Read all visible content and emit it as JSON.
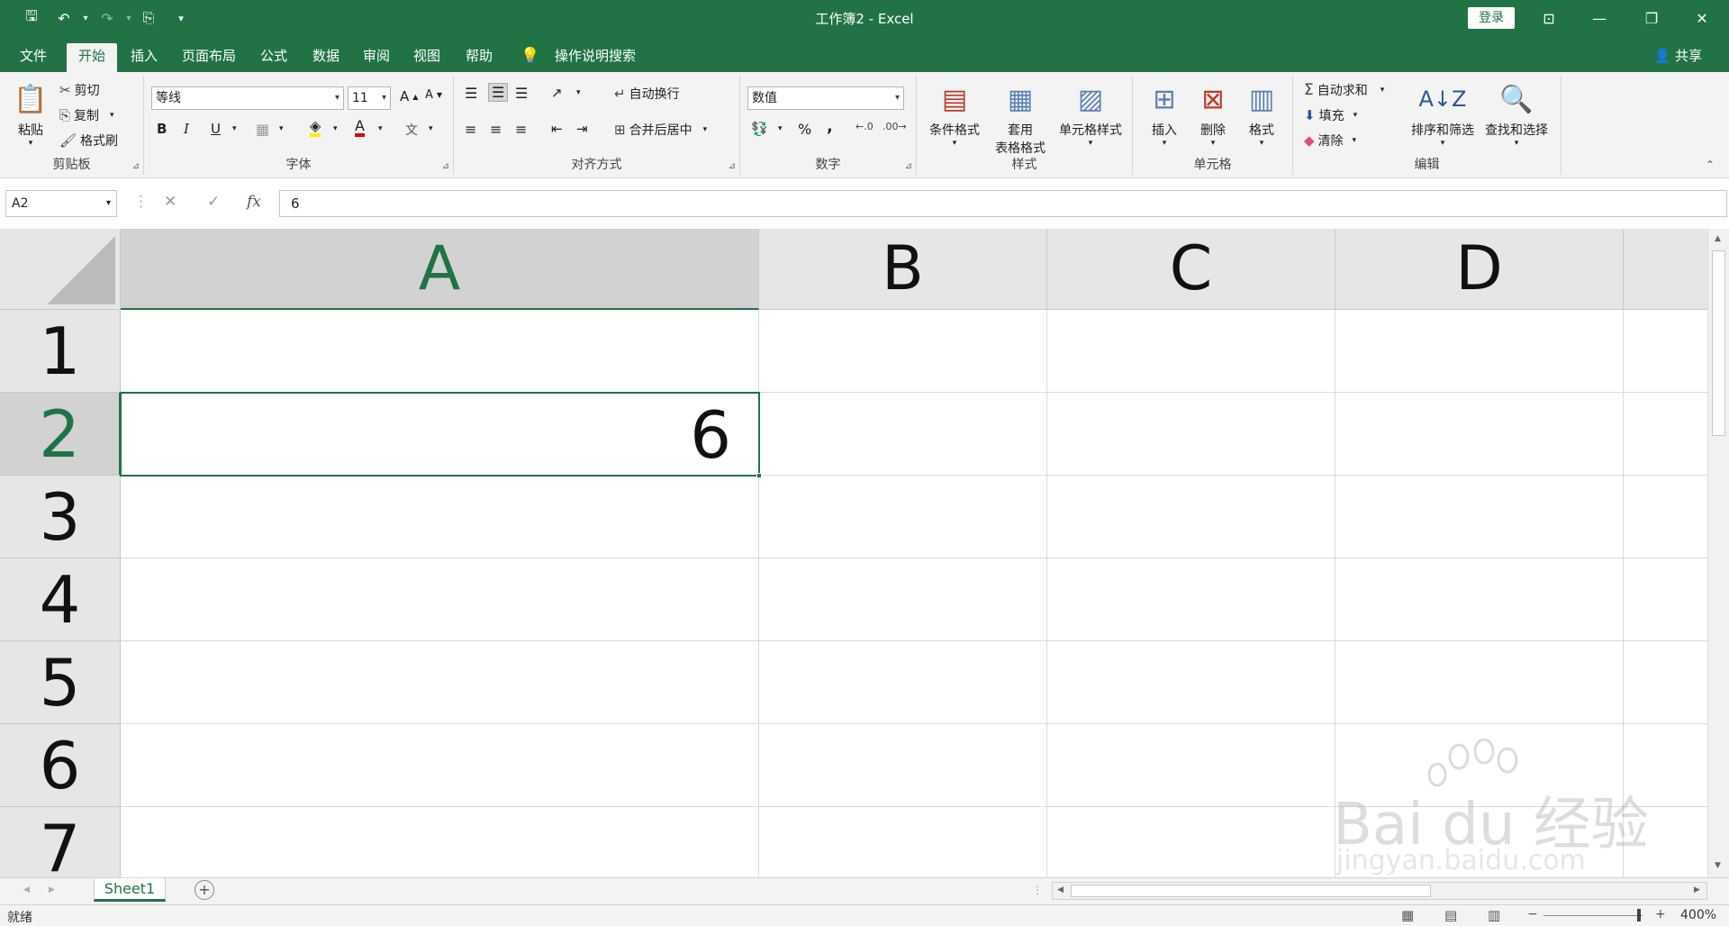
{
  "title_bar": {
    "title": "工作簿2  -  Excel",
    "login_label": "登录",
    "quick_access": [
      "save-icon",
      "undo-icon",
      "redo-icon",
      "touch-mode-icon",
      "customize-icon"
    ]
  },
  "tabs": [
    {
      "label": "文件",
      "active": false
    },
    {
      "label": "开始",
      "active": true
    },
    {
      "label": "插入",
      "active": false
    },
    {
      "label": "页面布局",
      "active": false
    },
    {
      "label": "公式",
      "active": false
    },
    {
      "label": "数据",
      "active": false
    },
    {
      "label": "审阅",
      "active": false
    },
    {
      "label": "视图",
      "active": false
    },
    {
      "label": "帮助",
      "active": false
    }
  ],
  "tell_me": "操作说明搜索",
  "share_label": "共享",
  "ribbon": {
    "clipboard": {
      "label": "剪贴板",
      "paste": "粘贴",
      "cut": "剪切",
      "copy": "复制",
      "format_painter": "格式刷"
    },
    "font": {
      "label": "字体",
      "font_name": "等线",
      "font_size": "11",
      "bold": "B",
      "italic": "I",
      "underline": "U"
    },
    "alignment": {
      "label": "对齐方式",
      "wrap_text": "自动换行",
      "merge_center": "合并后居中"
    },
    "number": {
      "label": "数字",
      "format": "数值",
      "percent": "%",
      "comma": ","
    },
    "styles": {
      "label": "样式",
      "conditional": "条件格式",
      "table_format_1": "套用",
      "table_format_2": "表格格式",
      "cell_styles": "单元格样式"
    },
    "cells": {
      "label": "单元格",
      "insert": "插入",
      "delete": "删除",
      "format": "格式"
    },
    "editing": {
      "label": "编辑",
      "autosum": "自动求和",
      "fill": "填充",
      "clear": "清除",
      "sort_filter": "排序和筛选",
      "find_select": "查找和选择"
    }
  },
  "formula_bar": {
    "name_box": "A2",
    "formula": "6",
    "fx": "fx"
  },
  "grid": {
    "columns": [
      "A",
      "B",
      "C",
      "D"
    ],
    "rows": [
      "1",
      "2",
      "3",
      "4",
      "5",
      "6",
      "7"
    ],
    "active_cell": "A2",
    "cells": {
      "A2": "6"
    }
  },
  "sheet_tabs": [
    {
      "label": "Sheet1",
      "active": true
    }
  ],
  "status_bar": {
    "status": "就绪",
    "zoom": "400%"
  },
  "watermark": {
    "brand": "Bai du 经验",
    "url": "jingyan.baidu.com"
  },
  "colors": {
    "accent": "#217346",
    "ribbon_bg": "#f3f3f3",
    "header_bg": "#e6e6e6"
  }
}
